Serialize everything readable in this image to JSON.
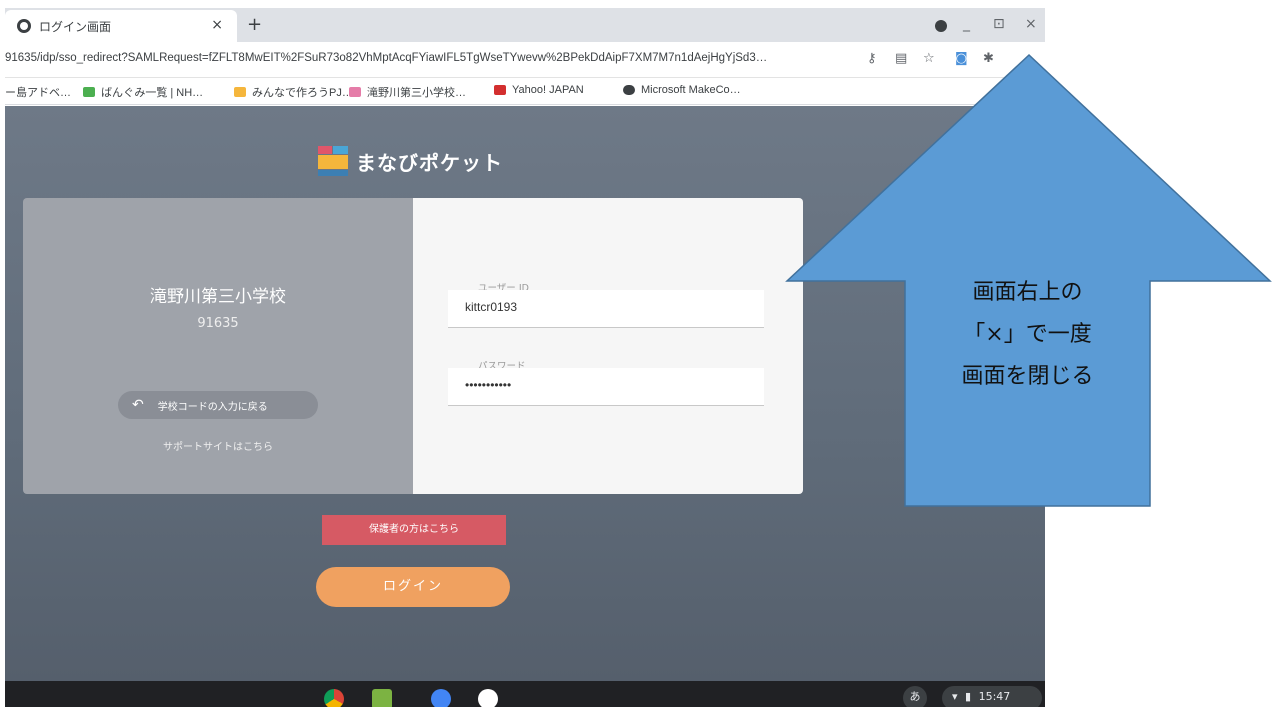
{
  "browser": {
    "tab_title": "ログイン画面",
    "tab_close": "×",
    "new_tab": "+",
    "window_controls": [
      "_",
      "⊡",
      "×"
    ],
    "url": "91635/idp/sso_redirect?SAMLRequest=fZFLT8MwEIT%2FSuR73o82VhMptAcqFYiawIFL5TgWseTYwevw%2BPekDdAipF7XM7M7n1dAejHgYjSd3…",
    "address_icons": [
      "key-icon",
      "translate-icon",
      "star-icon",
      "extension-icon",
      "puzzle-icon"
    ],
    "bookmarks": [
      {
        "label": "ー島アドベ…",
        "color": "#9e9e9e"
      },
      {
        "label": "ばんぐみ一覧 | NH…",
        "color": "#4caf50"
      },
      {
        "label": "みんなで作ろうPJ…",
        "color": "#f5b63c"
      },
      {
        "label": "滝野川第三小学校…",
        "color": "#e57ca8"
      },
      {
        "label": "Yahoo! JAPAN",
        "color": "#d32f2f"
      },
      {
        "label": "Microsoft MakeCo…",
        "color": "#3c4043"
      }
    ]
  },
  "page": {
    "logo_text": "まなびポケット",
    "school_name": "滝野川第三小学校",
    "school_code": "91635",
    "back_button": "学校コードの入力に戻る",
    "support_link": "サポートサイトはこちら",
    "user_id_label": "ユーザー ID",
    "user_id_value": "kittcr0193",
    "password_label": "パスワード",
    "password_value": "•••••••••••",
    "guardian_button": "保護者の方はこちら",
    "login_button": "ログイン"
  },
  "shelf": {
    "ime": "あ",
    "time": "15:47"
  },
  "annotation": {
    "lines": [
      "画面右上の",
      "「×」で一度",
      "画面を閉じる"
    ],
    "fill": "#5b9bd5",
    "stroke": "#41719c"
  }
}
